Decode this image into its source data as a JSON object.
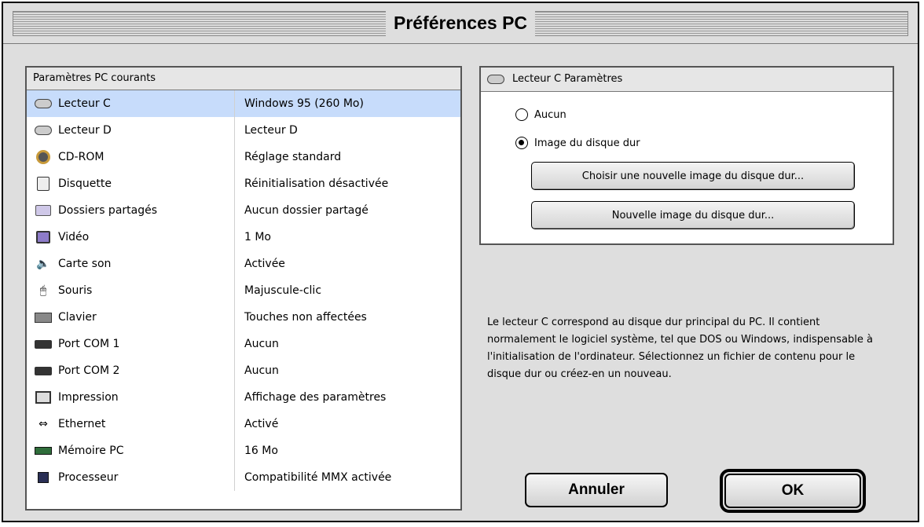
{
  "window": {
    "title": "Préférences PC"
  },
  "list": {
    "header": "Paramètres PC courants",
    "rows": [
      {
        "label": "Lecteur C",
        "value": "Windows 95 (260 Mo)",
        "icon": "drive-icon",
        "selected": true
      },
      {
        "label": "Lecteur D",
        "value": "Lecteur D",
        "icon": "drive-icon"
      },
      {
        "label": "CD-ROM",
        "value": "Réglage standard",
        "icon": "cdrom-icon"
      },
      {
        "label": "Disquette",
        "value": "Réinitialisation désactivée",
        "icon": "floppy-icon"
      },
      {
        "label": "Dossiers partagés",
        "value": "Aucun dossier partagé",
        "icon": "folder-icon"
      },
      {
        "label": "Vidéo",
        "value": "1 Mo",
        "icon": "video-icon"
      },
      {
        "label": "Carte son",
        "value": "Activée",
        "icon": "speaker-icon"
      },
      {
        "label": "Souris",
        "value": "Majuscule-clic",
        "icon": "mouse-icon"
      },
      {
        "label": "Clavier",
        "value": "Touches non affectées",
        "icon": "keyboard-icon"
      },
      {
        "label": "Port COM 1",
        "value": "Aucun",
        "icon": "port-icon"
      },
      {
        "label": "Port COM 2",
        "value": "Aucun",
        "icon": "port-icon"
      },
      {
        "label": "Impression",
        "value": "Affichage des paramètres",
        "icon": "printer-icon"
      },
      {
        "label": "Ethernet",
        "value": "Activé",
        "icon": "ethernet-icon"
      },
      {
        "label": "Mémoire PC",
        "value": "16 Mo",
        "icon": "memory-icon"
      },
      {
        "label": "Processeur",
        "value": "Compatibilité MMX activée",
        "icon": "processor-icon"
      }
    ]
  },
  "settings": {
    "header": "Lecteur C Paramètres",
    "radio_none": "Aucun",
    "radio_image": "Image du disque dur",
    "btn_choose": "Choisir une nouvelle image du disque dur...",
    "btn_new": "Nouvelle image du disque dur..."
  },
  "description": "Le lecteur C correspond au disque dur principal du PC. Il contient normalement le logiciel système, tel que DOS ou Windows, indispensable à l'initialisation de l'ordinateur. Sélectionnez un fichier de contenu pour le disque dur ou créez-en un nouveau.",
  "buttons": {
    "cancel": "Annuler",
    "ok": "OK"
  },
  "colors": {
    "selection": "#c7dcfb"
  }
}
